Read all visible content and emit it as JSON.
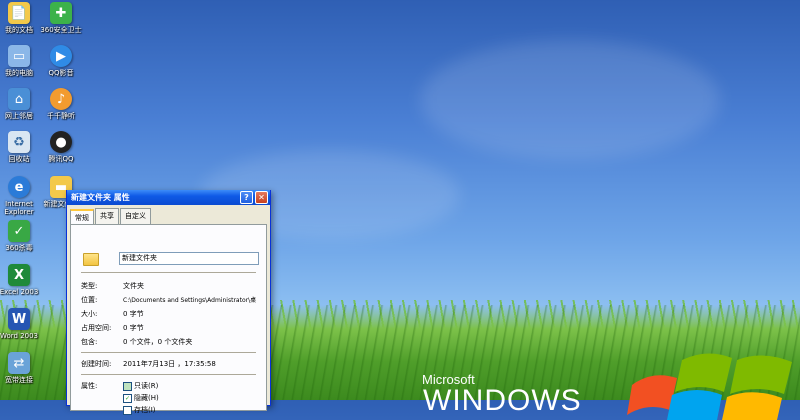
{
  "desktop_icons": [
    {
      "label": "我的文档",
      "icon": "my-documents-icon",
      "color": "#f3c94a"
    },
    {
      "label": "360安全卫士",
      "icon": "360-security-icon",
      "color": "#3cb24a"
    },
    {
      "label": "我的电脑",
      "icon": "my-computer-icon",
      "color": "#8bb7e8"
    },
    {
      "label": "QQ影音",
      "icon": "qq-player-icon",
      "color": "#2f8be6"
    },
    {
      "label": "网上邻居",
      "icon": "network-icon",
      "color": "#4a8fd6"
    },
    {
      "label": "千千静听",
      "icon": "ttplayer-icon",
      "color": "#f29b2f"
    },
    {
      "label": "回收站",
      "icon": "recycle-bin-icon",
      "color": "#d9e6f2"
    },
    {
      "label": "腾讯QQ",
      "icon": "qq-penguin-icon",
      "color": "#222222"
    },
    {
      "label": "Internet\nExplorer",
      "icon": "ie-icon",
      "color": "#2b7bd8"
    },
    {
      "label": "新建文件夹",
      "icon": "folder-icon",
      "color": "#f3c94a"
    },
    {
      "label": "360杀毒",
      "icon": "360-antivirus-icon",
      "color": "#39a845"
    },
    {
      "label": "Excel 2003",
      "icon": "excel-icon",
      "color": "#1f8a3a"
    },
    {
      "label": "Word 2003",
      "icon": "word-icon",
      "color": "#2656b3"
    },
    {
      "label": "宽带连接",
      "icon": "broadband-icon",
      "color": "#6aa3d8"
    }
  ],
  "wallpaper": {
    "microsoft": "Microsoft",
    "windows": "WINDOWS"
  },
  "dialog": {
    "title": "新建文件夹 属性",
    "help_btn": "?",
    "close_btn": "✕",
    "tabs": [
      "常规",
      "共享",
      "自定义"
    ],
    "name_value": "新建文件夹",
    "props": [
      {
        "label": "类型:",
        "value": "文件夹"
      },
      {
        "label": "位置:",
        "value": "C:\\Documents and Settings\\Administrator\\桌"
      },
      {
        "label": "大小:",
        "value": "0 字节"
      },
      {
        "label": "占用空间:",
        "value": "0 字节"
      },
      {
        "label": "包含:",
        "value": "0 个文件，0 个文件夹"
      },
      {
        "label": "创建时间:",
        "value": "2011年7月13日 ，17:35:58"
      }
    ],
    "attributes_label": "属性:",
    "attributes": [
      {
        "label": "只读(R)",
        "checked": false,
        "partial": true
      },
      {
        "label": "隐藏(H)",
        "checked": true
      },
      {
        "label": "存档(I)",
        "checked": false
      }
    ]
  }
}
